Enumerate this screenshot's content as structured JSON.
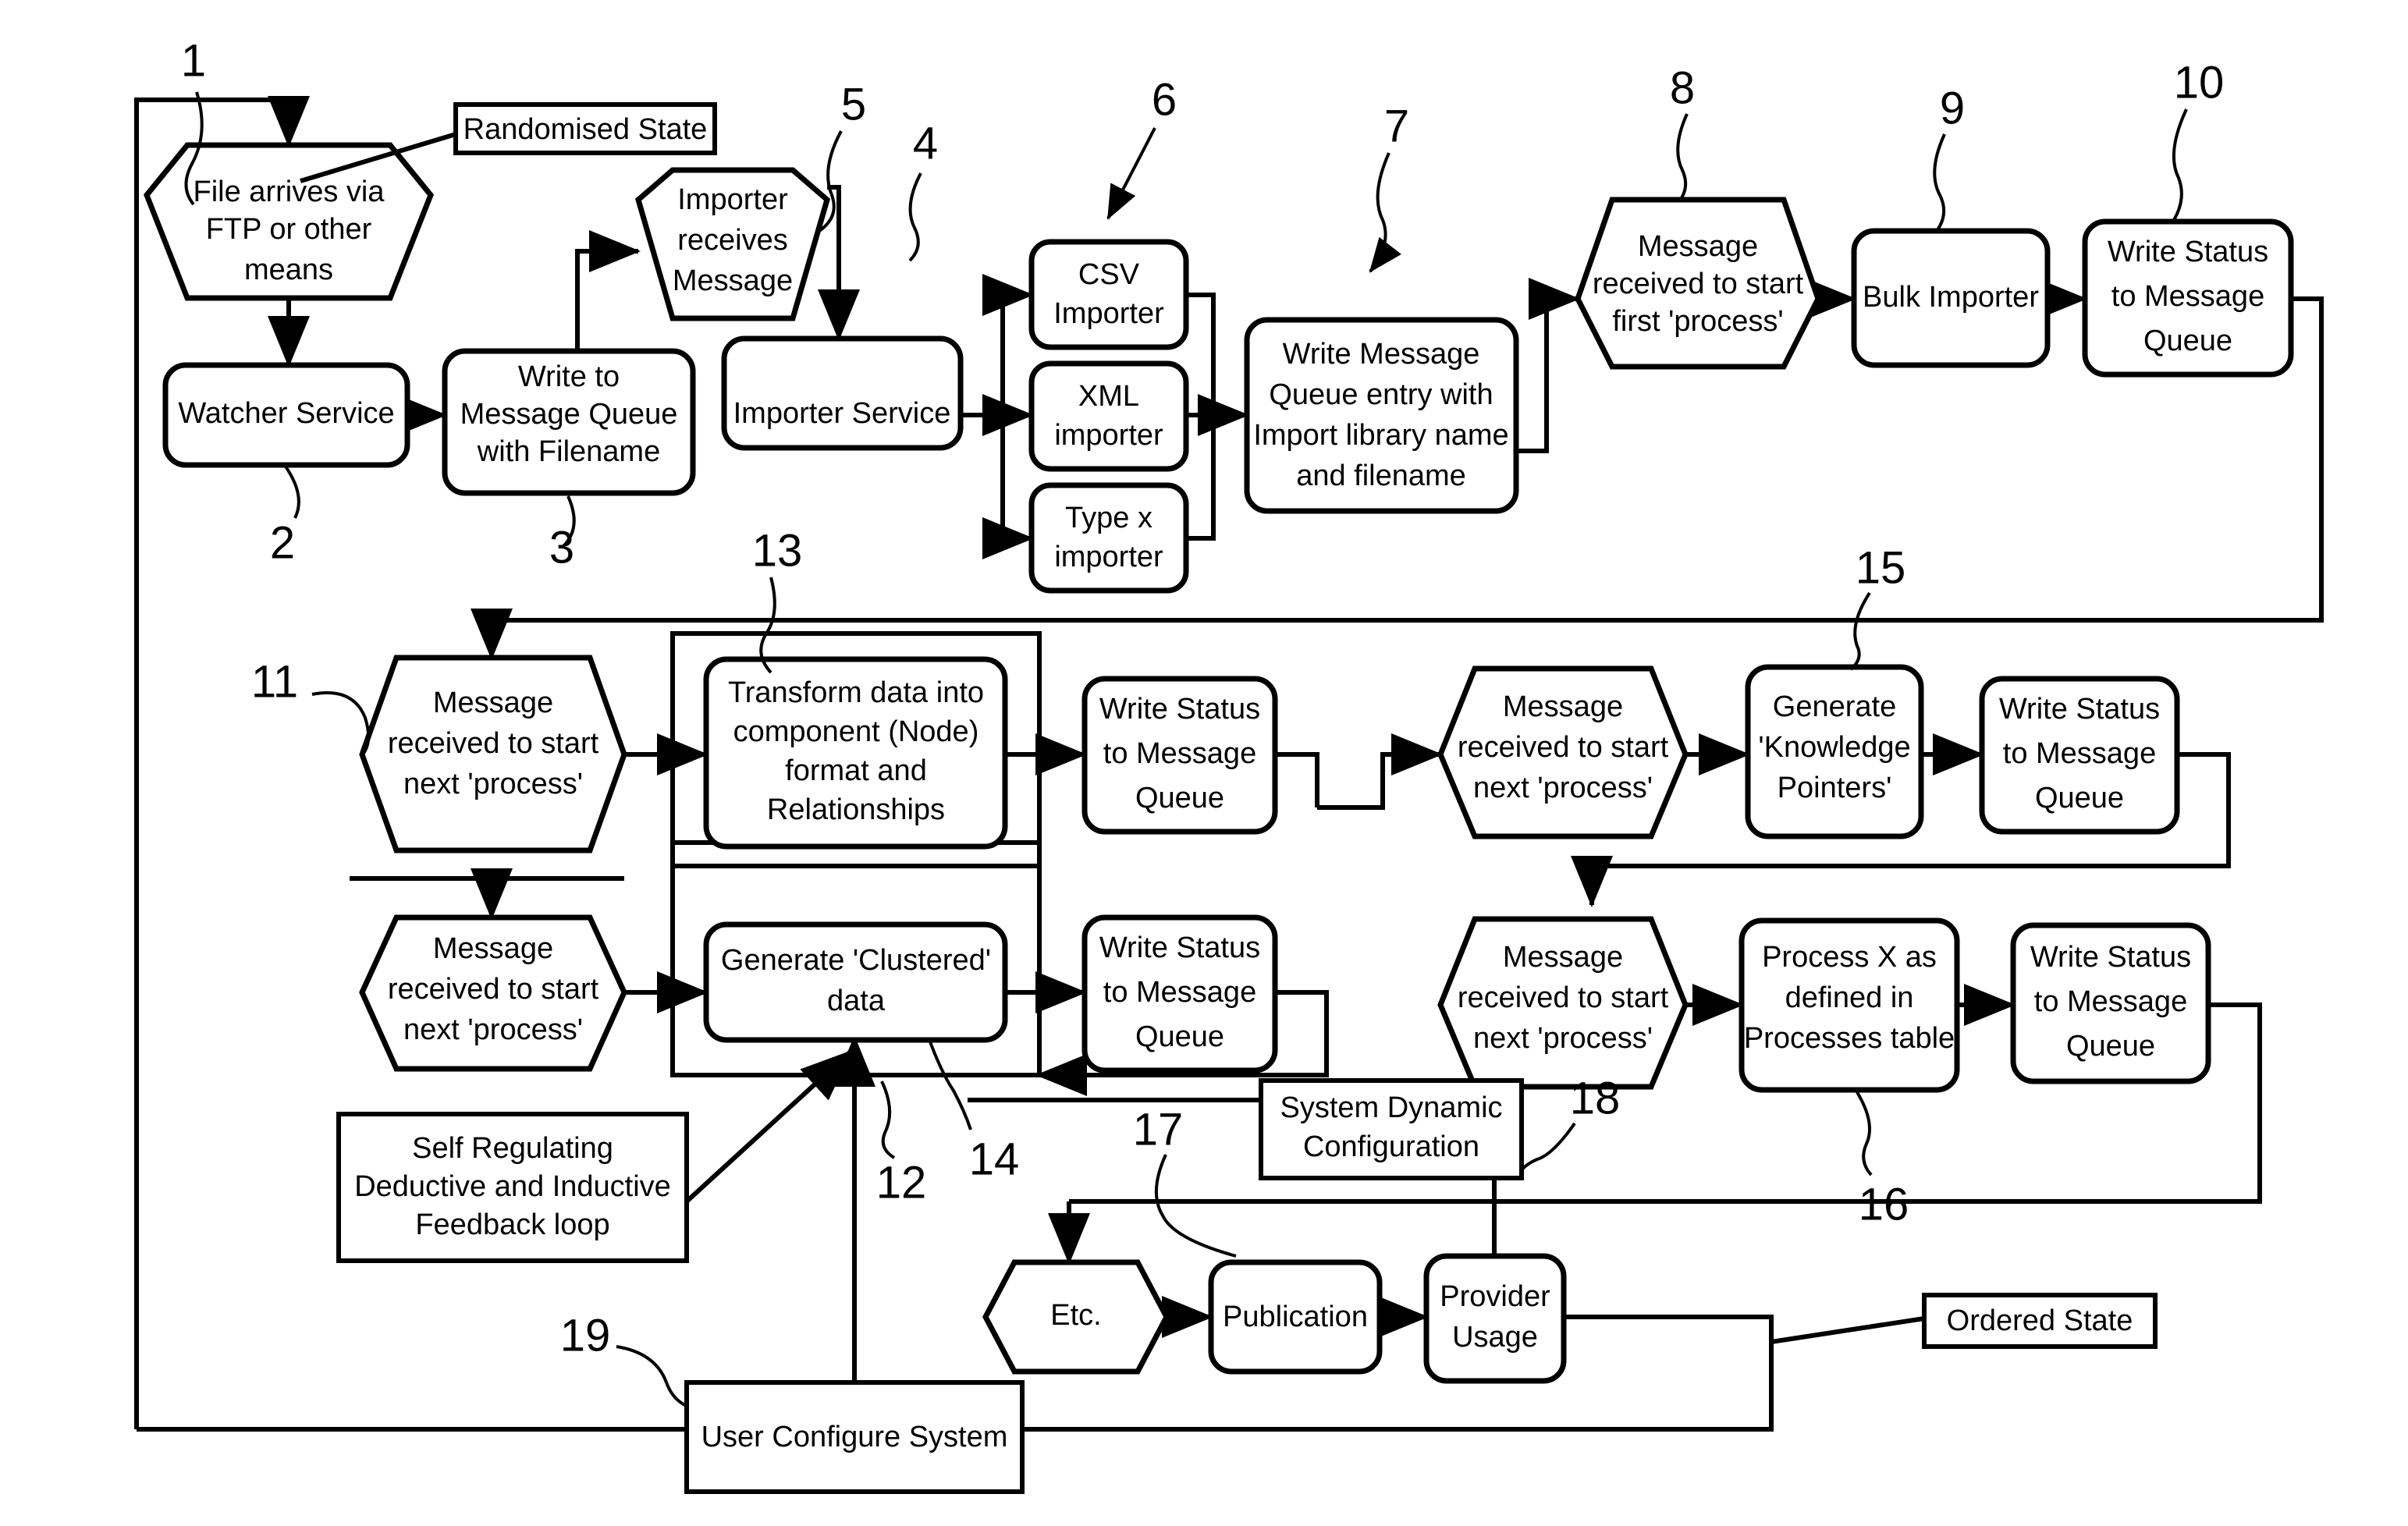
{
  "diagram": {
    "title": "System process flow diagram",
    "ink_color": "#000000",
    "background_color": "#ffffff",
    "nodes": [
      {
        "id": "file_arrives",
        "label_lines": [
          "File arrives via",
          "FTP or other",
          "means"
        ],
        "shape": "hexagon"
      },
      {
        "id": "randomised_state",
        "label_lines": [
          "Randomised State"
        ],
        "shape": "rect-sharp"
      },
      {
        "id": "watcher_service",
        "label_lines": [
          "Watcher Service"
        ],
        "shape": "rounded-rect"
      },
      {
        "id": "write_mq_filename",
        "label_lines": [
          "Write to",
          "Message Queue",
          "with Filename"
        ],
        "shape": "rounded-rect"
      },
      {
        "id": "importer_receives",
        "label_lines": [
          "Importer",
          "receives",
          "Message"
        ],
        "shape": "hexagon"
      },
      {
        "id": "importer_service",
        "label_lines": [
          "Importer Service"
        ],
        "shape": "rounded-rect"
      },
      {
        "id": "csv_importer",
        "label_lines": [
          "CSV",
          "Importer"
        ],
        "shape": "rounded-rect"
      },
      {
        "id": "xml_importer",
        "label_lines": [
          "XML",
          "importer"
        ],
        "shape": "rounded-rect"
      },
      {
        "id": "typex_importer",
        "label_lines": [
          "Type x",
          "importer"
        ],
        "shape": "rounded-rect"
      },
      {
        "id": "write_mq_entry",
        "label_lines": [
          "Write Message",
          "Queue entry with",
          "Import library name",
          "and filename"
        ],
        "shape": "rounded-rect"
      },
      {
        "id": "msg_first_process",
        "label_lines": [
          "Message",
          "received to start",
          "first 'process'"
        ],
        "shape": "hexagon"
      },
      {
        "id": "bulk_importer",
        "label_lines": [
          "Bulk Importer"
        ],
        "shape": "rounded-rect"
      },
      {
        "id": "write_status_1",
        "label_lines": [
          "Write Status",
          "to Message",
          "Queue"
        ],
        "shape": "rounded-rect"
      },
      {
        "id": "msg_next_process_1",
        "label_lines": [
          "Message",
          "received to start",
          "next 'process'"
        ],
        "shape": "hexagon"
      },
      {
        "id": "transform_data",
        "label_lines": [
          "Transform data into",
          "component (Node)",
          "format and",
          "Relationships"
        ],
        "shape": "rounded-rect"
      },
      {
        "id": "write_status_2",
        "label_lines": [
          "Write Status",
          "to Message",
          "Queue"
        ],
        "shape": "rounded-rect"
      },
      {
        "id": "msg_next_process_2",
        "label_lines": [
          "Message",
          "received to start",
          "next 'process'"
        ],
        "shape": "hexagon"
      },
      {
        "id": "generate_clustered",
        "label_lines": [
          "Generate 'Clustered'",
          "data"
        ],
        "shape": "rounded-rect"
      },
      {
        "id": "write_status_3",
        "label_lines": [
          "Write Status",
          "to Message",
          "Queue"
        ],
        "shape": "rounded-rect"
      },
      {
        "id": "msg_next_process_3",
        "label_lines": [
          "Message",
          "received to start",
          "next 'process'"
        ],
        "shape": "hexagon"
      },
      {
        "id": "generate_knowledge",
        "label_lines": [
          "Generate",
          "'Knowledge",
          "Pointers'"
        ],
        "shape": "rounded-rect"
      },
      {
        "id": "write_status_4",
        "label_lines": [
          "Write Status",
          "to Message",
          "Queue"
        ],
        "shape": "rounded-rect"
      },
      {
        "id": "msg_next_process_4",
        "label_lines": [
          "Message",
          "received to start",
          "next 'process'"
        ],
        "shape": "hexagon"
      },
      {
        "id": "process_x",
        "label_lines": [
          "Process X as",
          "defined in",
          "Processes table"
        ],
        "shape": "rounded-rect"
      },
      {
        "id": "write_status_5",
        "label_lines": [
          "Write Status",
          "to Message",
          "Queue"
        ],
        "shape": "rounded-rect"
      },
      {
        "id": "self_regulating",
        "label_lines": [
          "Self Regulating",
          "Deductive and Inductive",
          "Feedback loop"
        ],
        "shape": "rect-sharp"
      },
      {
        "id": "system_dynamic_config",
        "label_lines": [
          "System Dynamic",
          "Configuration"
        ],
        "shape": "rect-sharp"
      },
      {
        "id": "etc",
        "label_lines": [
          "Etc."
        ],
        "shape": "hexagon"
      },
      {
        "id": "publication",
        "label_lines": [
          "Publication"
        ],
        "shape": "rounded-rect"
      },
      {
        "id": "provider_usage",
        "label_lines": [
          "Provider",
          "Usage"
        ],
        "shape": "rounded-rect"
      },
      {
        "id": "ordered_state",
        "label_lines": [
          "Ordered State"
        ],
        "shape": "rect-sharp"
      },
      {
        "id": "user_configure_system",
        "label_lines": [
          "User Configure System"
        ],
        "shape": "rect-sharp"
      }
    ],
    "reference_numbers": [
      {
        "id": "ref1",
        "value": "1"
      },
      {
        "id": "ref2",
        "value": "2"
      },
      {
        "id": "ref3",
        "value": "3"
      },
      {
        "id": "ref4",
        "value": "4"
      },
      {
        "id": "ref5",
        "value": "5"
      },
      {
        "id": "ref6",
        "value": "6"
      },
      {
        "id": "ref7",
        "value": "7"
      },
      {
        "id": "ref8",
        "value": "8"
      },
      {
        "id": "ref9",
        "value": "9"
      },
      {
        "id": "ref10",
        "value": "10"
      },
      {
        "id": "ref11",
        "value": "11"
      },
      {
        "id": "ref12",
        "value": "12"
      },
      {
        "id": "ref13",
        "value": "13"
      },
      {
        "id": "ref14",
        "value": "14"
      },
      {
        "id": "ref15",
        "value": "15"
      },
      {
        "id": "ref16",
        "value": "16"
      },
      {
        "id": "ref17",
        "value": "17"
      },
      {
        "id": "ref18",
        "value": "18"
      },
      {
        "id": "ref19",
        "value": "19"
      }
    ]
  }
}
